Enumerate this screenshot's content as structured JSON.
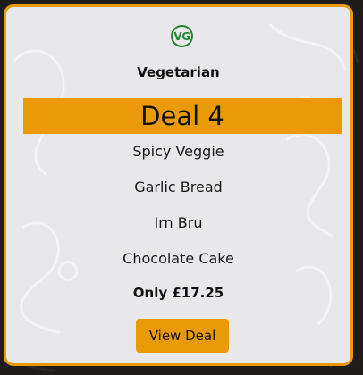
{
  "card": {
    "badge_text": "VG",
    "category": "Vegetarian",
    "deal_title": "Deal 4",
    "items": [
      "Spicy Veggie",
      "Garlic Bread",
      "Irn Bru",
      "Chocolate Cake"
    ],
    "price_text": "Only £17.25",
    "button_label": "View Deal"
  },
  "colors": {
    "accent": "#e99a06",
    "card_bg": "#e8e7e9",
    "page_bg": "#1f1d1c",
    "vegetarian_green": "#1e8a32"
  },
  "icons": {
    "badge": "vegetarian-badge-icon"
  }
}
